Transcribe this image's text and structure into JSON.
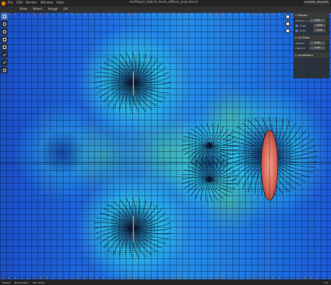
{
  "topbar": {
    "menus": [
      "File",
      "Edit",
      "Render",
      "Window",
      "Help"
    ],
    "file_title": "multilayer_hybrid_mesh_diffuse_prop.blend",
    "scene": "Emode_muscle_LCSS"
  },
  "header": {
    "menus": [
      "View",
      "Select",
      "Image",
      "UV"
    ]
  },
  "toolbar": {
    "tools": [
      "cursor-icon",
      "move-icon",
      "rotate-icon",
      "scale-icon",
      "transform-icon",
      "annotate-icon",
      "measure-icon",
      "pin-icon"
    ]
  },
  "npanel": {
    "display_header": "Display",
    "rows": [
      {
        "label": "Stretch: A",
        "value": "0.00"
      },
      {
        "label": "Cage",
        "value": "0.00"
      },
      {
        "label": "Area",
        "value": "0.02"
      }
    ],
    "overlays_header": "UV Editor",
    "overlay_rows": [
      {
        "label": "Stretch",
        "value": "0.49"
      },
      {
        "label": "Opacity",
        "value": "1.00"
      }
    ],
    "annotations_header": "Annotations"
  },
  "status": {
    "items": [
      "Select",
      "Box Select",
      "Pan View"
    ],
    "version": "3.6"
  },
  "colors": {
    "accent": "#4772b3",
    "mesh_blue": "#1e64e0",
    "mesh_cyan": "#2ec8e8",
    "mesh_green": "#5ad47c",
    "wire": "#0a0f20",
    "highlight": "#e88a7a"
  }
}
